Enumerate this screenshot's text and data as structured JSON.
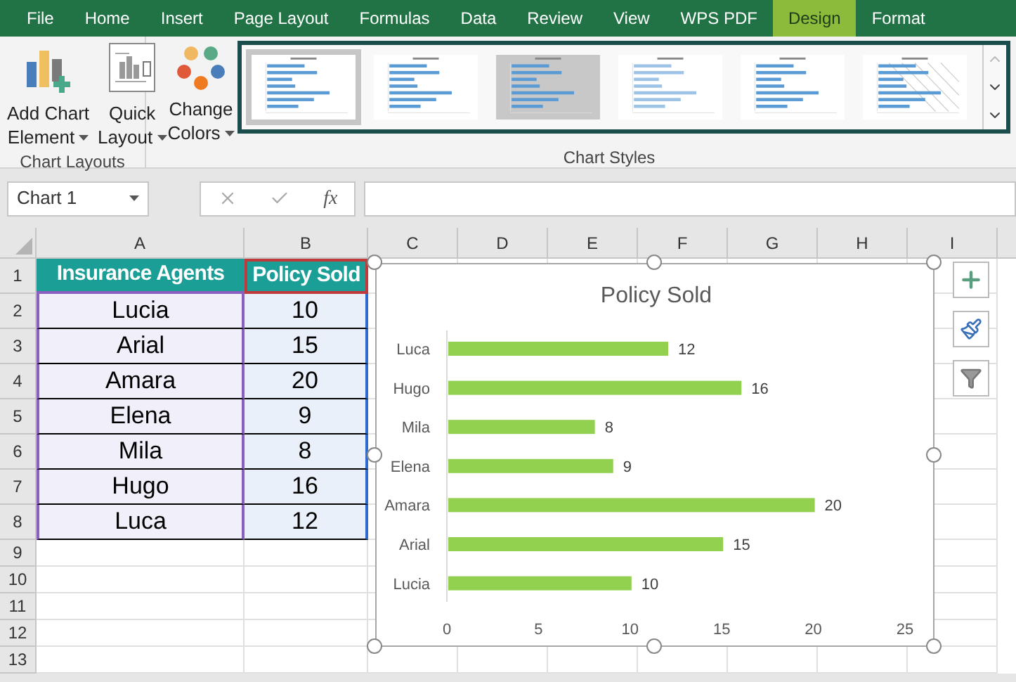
{
  "tabs": [
    {
      "label": "File",
      "selected": false
    },
    {
      "label": "Home",
      "selected": false
    },
    {
      "label": "Insert",
      "selected": false
    },
    {
      "label": "Page Layout",
      "selected": false
    },
    {
      "label": "Formulas",
      "selected": false
    },
    {
      "label": "Data",
      "selected": false
    },
    {
      "label": "Review",
      "selected": false
    },
    {
      "label": "View",
      "selected": false
    },
    {
      "label": "WPS PDF",
      "selected": false
    },
    {
      "label": "Design",
      "selected": true
    },
    {
      "label": "Format",
      "selected": false
    }
  ],
  "ribbon": {
    "chart_layouts": {
      "label": "Chart Layouts",
      "buttons": [
        {
          "kind": "add",
          "line1": "Add Chart",
          "line2": "Element"
        },
        {
          "kind": "layout",
          "line1": "Quick",
          "line2": "Layout"
        }
      ]
    },
    "colors": {
      "line1": "Change",
      "line2": "Colors"
    },
    "chart_styles": {
      "label": "Chart Styles",
      "items": [
        {
          "selected": true
        },
        {
          "selected": false
        },
        {
          "selected": false
        },
        {
          "selected": false
        },
        {
          "selected": false
        },
        {
          "selected": false
        }
      ]
    }
  },
  "formula_bar": {
    "name_box": "Chart 1",
    "function_label": "fx"
  },
  "sheet": {
    "columns": [
      "A",
      "B",
      "C",
      "D",
      "E",
      "F",
      "G",
      "H",
      "I"
    ],
    "row_numbers": [
      "1",
      "2",
      "3",
      "4",
      "5",
      "6",
      "7",
      "8",
      "9",
      "10",
      "11",
      "12",
      "13"
    ],
    "header": [
      "Insurance Agents",
      "Policy Sold"
    ],
    "rows": [
      [
        "Lucia",
        "10"
      ],
      [
        "Arial",
        "15"
      ],
      [
        "Amara",
        "20"
      ],
      [
        "Elena",
        "9"
      ],
      [
        "Mila",
        "8"
      ],
      [
        "Hugo",
        "16"
      ],
      [
        "Luca",
        "12"
      ]
    ]
  },
  "chart": {
    "chart_data": {
      "type": "bar",
      "orientation": "horizontal",
      "title": "Policy Sold",
      "categories": [
        "Luca",
        "Hugo",
        "Mila",
        "Elena",
        "Amara",
        "Arial",
        "Lucia"
      ],
      "series": [
        {
          "color": "#92d050",
          "values": [
            12,
            16,
            8,
            9,
            20,
            15,
            10
          ]
        }
      ],
      "xlim": [
        0,
        25
      ],
      "xticks": [
        0,
        5,
        10,
        15,
        20,
        25
      ],
      "data_labels": true
    }
  }
}
